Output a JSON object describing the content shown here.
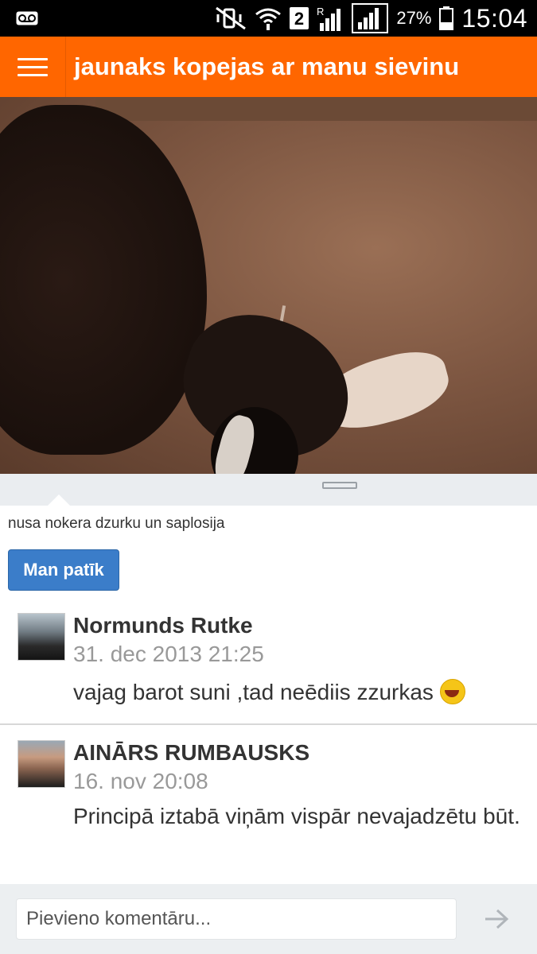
{
  "status_bar": {
    "battery": "27%",
    "time": "15:04",
    "sim_number": "2",
    "roaming": "R",
    "icons": [
      "voicemail-icon",
      "mute-vibrate-icon",
      "wifi-icon",
      "sim2-icon",
      "signal-roaming-icon",
      "signal-icon",
      "battery-icon"
    ]
  },
  "app_bar": {
    "title": "jaunaks kopejas ar manu sievinu",
    "menu_icon": "hamburger-menu-icon"
  },
  "post": {
    "caption": "nusa nokera dzurku un saplosija",
    "like_label": "Man patīk"
  },
  "comments": [
    {
      "author": "Normunds Rutke",
      "date": "31. dec 2013 21:25",
      "text": "vajag barot suni ,tad neēdiis zzurkas",
      "emoji": "laughing-emoji"
    },
    {
      "author": "AINĀRS RUMBAUSKS",
      "date": "16. nov 20:08",
      "text": "Principā iztabā viņām vispār nevajadzētu būt."
    }
  ],
  "footer": {
    "comment_placeholder": "Pievieno komentāru...",
    "send_icon": "arrow-right-icon"
  },
  "colors": {
    "accent": "#ff6600",
    "button": "#3b7dc9",
    "date_gray": "#999999",
    "text": "#333333"
  }
}
